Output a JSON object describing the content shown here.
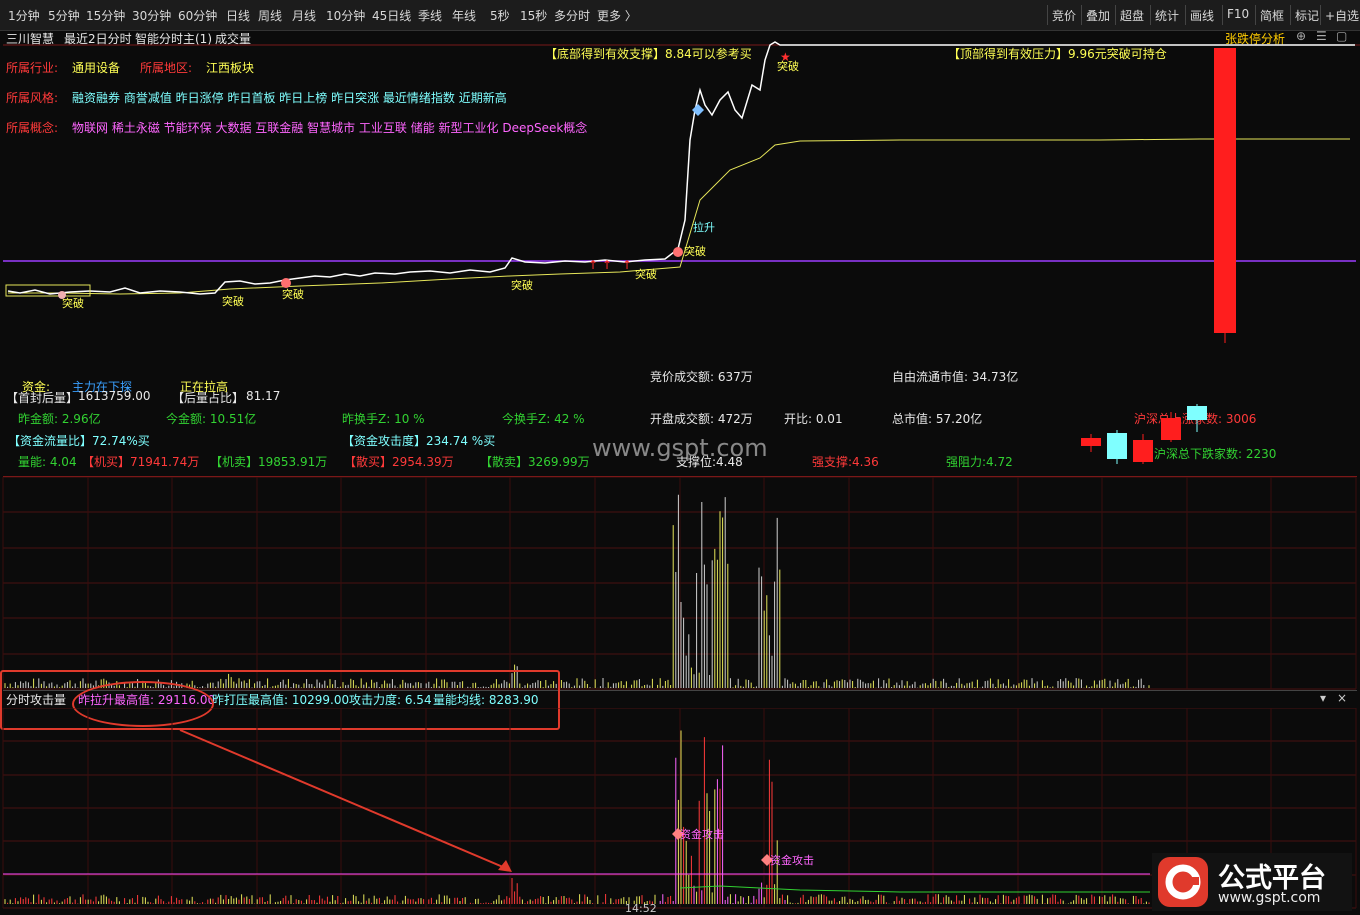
{
  "toolbar": {
    "timeframes": [
      "1分钟",
      "5分钟",
      "15分钟",
      "30分钟",
      "60分钟",
      "日线",
      "周线",
      "月线",
      "10分钟",
      "45日线",
      "季线",
      "年线",
      "5秒",
      "15秒",
      "多分时",
      "更多 〉"
    ],
    "right_tools": [
      "竞价",
      "叠加",
      "超盘",
      "统计",
      "画线",
      "F10",
      "简框",
      "标记",
      "+自选"
    ]
  },
  "header": {
    "stock_name": "三川智慧",
    "mode": "最近2日分时",
    "indicator": "智能分时主(1)",
    "volume_label": "成交量",
    "analysis_link": "张跌停分析"
  },
  "info": {
    "industry_label": "所属行业:",
    "industry": "通用设备",
    "region_label": "所属地区:",
    "region": "江西板块",
    "style_label": "所属风格:",
    "styles": "融资融券 商誉减值 昨日涨停 昨日首板 昨日上榜 昨日突涨 最近情绪指数 近期新高",
    "concept_label": "所属概念:",
    "concepts": "物联网 稀土永磁 节能环保 大数据 互联金融 智慧城市 工业互联 储能 新型工业化 DeepSeek概念"
  },
  "annotations": {
    "support": "【底部得到有效支撑】8.84可以参考买",
    "pressure": "【顶部得到有效压力】9.96元突破可持仓",
    "breakout": "突破",
    "pull_up": "拉升",
    "star": "★"
  },
  "stats": {
    "capital_label": "资金:",
    "capital_status": "主力在下探",
    "rising_status": "正在拉高",
    "first_seal_label": "【首封后量】",
    "first_seal": "1613759.00",
    "after_ratio_label": "【后量占比】",
    "after_ratio": "81.17",
    "auction_amount": "竞价成交额: 637万",
    "float_cap": "自由流通市值: 34.73亿",
    "yesterday_amount": "昨金额: 2.96亿",
    "today_amount": "今金额: 10.51亿",
    "yesterday_turnover": "昨换手Z: 10 %",
    "today_turnover": "今换手Z: 42 %",
    "open_amount": "开盘成交额: 472万",
    "open_ratio": "开比: 0.01",
    "total_cap": "总市值: 57.20亿",
    "hs_up": "沪深总上涨家数: 3006",
    "hs_down": "沪深总下跌家数: 2230",
    "flow_ratio": "【资金流量比】72.74%买",
    "attack_degree": "【资金攻击度】234.74 %买",
    "volume_energy": "量能: 4.04",
    "inst_buy": "【机买】71941.74万",
    "inst_sell": "【机卖】19853.91万",
    "retail_buy": "【散买】2954.39万",
    "retail_sell": "【散卖】3269.99万",
    "support_level": "支撑位:4.48",
    "strong_support": "强支撑:4.36",
    "strong_resist": "强阻力:4.72",
    "watermark": "www.gspt.com"
  },
  "attack_panel": {
    "title": "分时攻击量",
    "pull_max": "昨拉升最高值: 29116.00",
    "press_max": "昨打压最高值: 10299.00",
    "attack_force": "攻击力度: 6.54",
    "avg_line": "量能均线: 8283.90",
    "tag1": "资金攻击",
    "tag2": "资金攻击",
    "time_label": "14:52",
    "close_icon": "×",
    "menu_icon": "▾"
  },
  "logo": {
    "text": "公式平台",
    "url": "www.gspt.com"
  },
  "colors": {
    "red": "#ff2a2a",
    "cyan": "#7fffff",
    "yellow": "#ffff00",
    "green": "#32d232",
    "magenta": "#ff4dff",
    "purple_line": "#9d3cff",
    "label_red": "#ff3a3a"
  }
}
